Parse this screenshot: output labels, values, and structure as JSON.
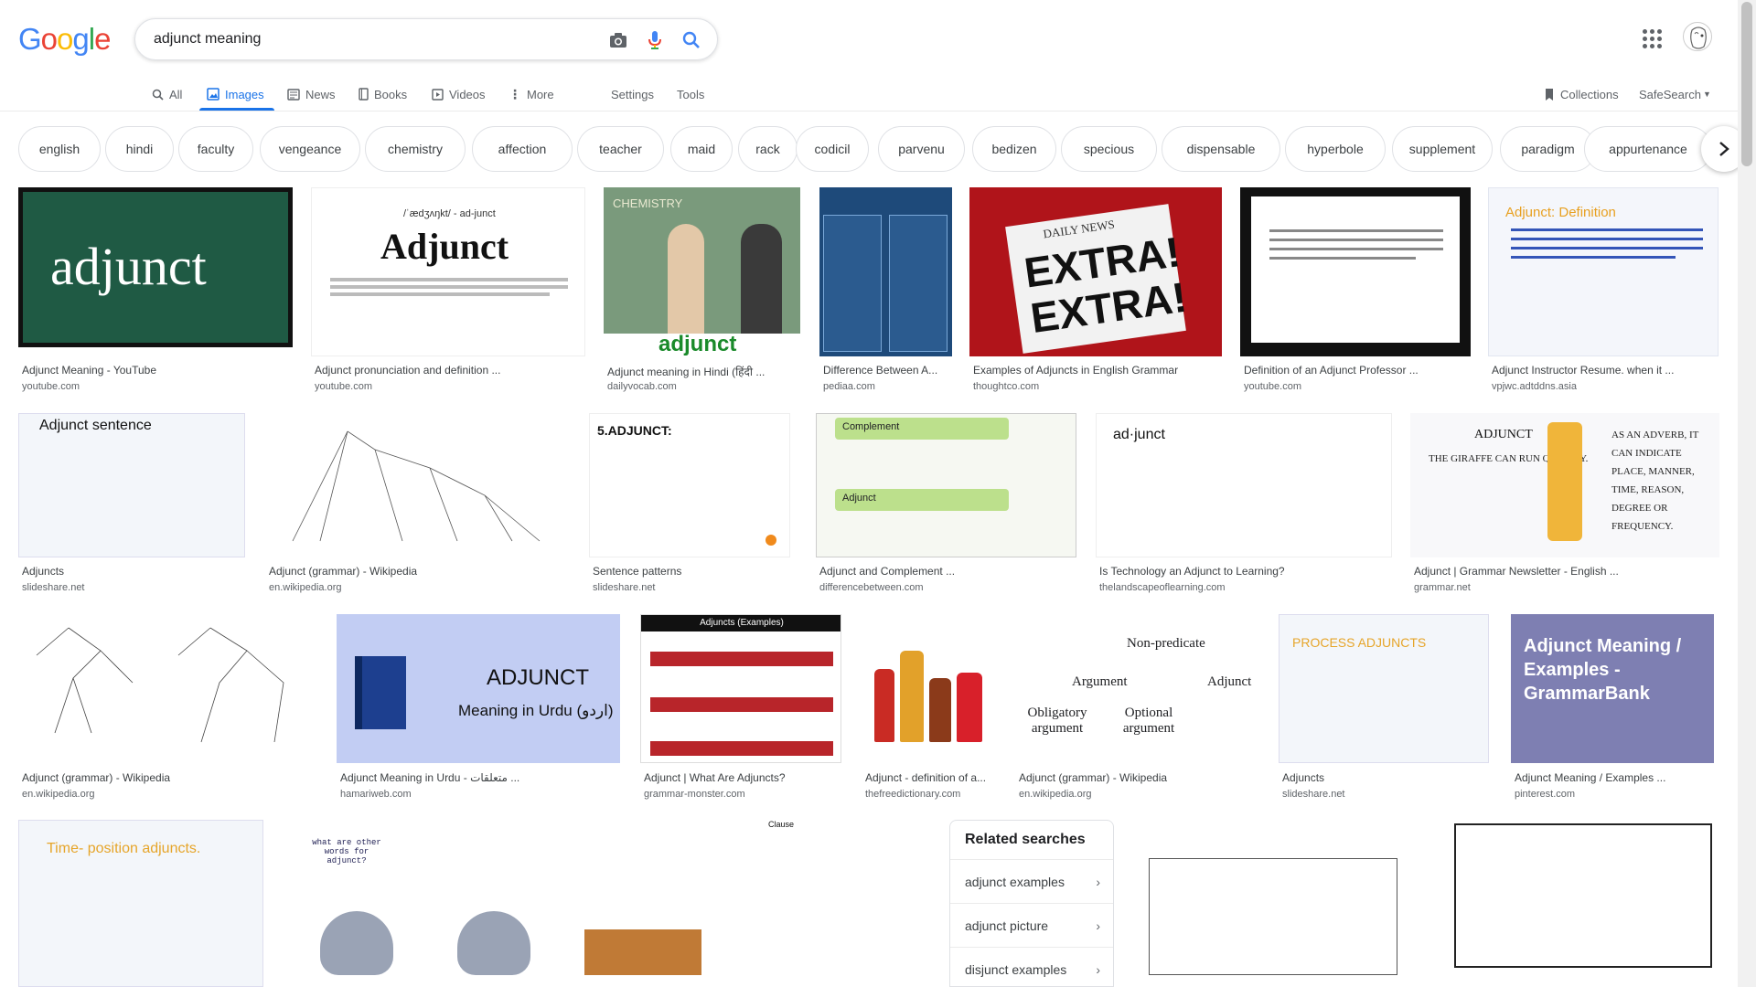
{
  "logo": {
    "letters": [
      "G",
      "o",
      "o",
      "g",
      "l",
      "e"
    ],
    "colors": [
      "#4285f4",
      "#ea4335",
      "#fbbc05",
      "#4285f4",
      "#34a853",
      "#ea4335"
    ]
  },
  "search": {
    "query": "adjunct meaning"
  },
  "nav": {
    "tabs": [
      {
        "label": "All"
      },
      {
        "label": "Images"
      },
      {
        "label": "News"
      },
      {
        "label": "Books"
      },
      {
        "label": "Videos"
      },
      {
        "label": "More"
      }
    ],
    "settings": "Settings",
    "tools": "Tools",
    "collections": "Collections",
    "safesearch": "SafeSearch"
  },
  "chips": [
    "english",
    "hindi",
    "faculty",
    "vengeance",
    "chemistry",
    "affection",
    "teacher",
    "maid",
    "rack",
    "codicil",
    "parvenu",
    "bedizen",
    "specious",
    "dispensable",
    "hyperbole",
    "supplement",
    "paradigm",
    "appurtenance"
  ],
  "results": [
    {
      "title": "Adjunct Meaning - YouTube",
      "source": "youtube.com"
    },
    {
      "title": "Adjunct pronunciation and definition ...",
      "source": "youtube.com"
    },
    {
      "title": "Adjunct meaning in Hindi (हिंदी ...",
      "source": "dailyvocab.com"
    },
    {
      "title": "Difference Between A...",
      "source": "pediaa.com"
    },
    {
      "title": "Examples of Adjuncts in English Grammar",
      "source": "thoughtco.com"
    },
    {
      "title": "Definition of an Adjunct Professor ...",
      "source": "youtube.com"
    },
    {
      "title": "Adjunct Instructor Resume. when it ...",
      "source": "vpjwc.adtddns.asia"
    },
    {
      "title": "Adjuncts",
      "source": "slideshare.net"
    },
    {
      "title": "Adjunct (grammar) - Wikipedia",
      "source": "en.wikipedia.org"
    },
    {
      "title": "Sentence patterns",
      "source": "slideshare.net"
    },
    {
      "title": "Adjunct and Complement ...",
      "source": "differencebetween.com"
    },
    {
      "title": "Is Technology an Adjunct to Learning?",
      "source": "thelandscapeoflearning.com"
    },
    {
      "title": "Adjunct | Grammar Newsletter - English ...",
      "source": "grammar.net"
    },
    {
      "title": "Adjunct (grammar) - Wikipedia",
      "source": "en.wikipedia.org"
    },
    {
      "title": "Adjunct Meaning in Urdu - متعلقات ...",
      "source": "hamariweb.com"
    },
    {
      "title": "Adjunct | What Are Adjuncts?",
      "source": "grammar-monster.com"
    },
    {
      "title": "Adjunct - definition of a...",
      "source": "thefreedictionary.com"
    },
    {
      "title": "Adjunct (grammar) - Wikipedia",
      "source": "en.wikipedia.org"
    },
    {
      "title": "Adjuncts",
      "source": "slideshare.net"
    },
    {
      "title": "Adjunct Meaning / Examples ...",
      "source": "pinterest.com"
    }
  ],
  "thumb_texts": {
    "t0": "adjunct",
    "t1_phon": "/ˈædʒʌŋkt/ - ad-junct",
    "t1_word": "Adjunct",
    "t2_top": "CHEMISTRY",
    "t2_word": "adjunct",
    "t4_a": "DAILY NEWS",
    "t4_b": "EXTRA!",
    "t4_c": "EXTRA!",
    "t6": "Adjunct: Definition",
    "t7": "Adjunct sentence",
    "t9": "5.ADJUNCT:",
    "t10_a": "Complement",
    "t10_b": "Adjunct",
    "t11": "ad·junct",
    "t12_a": "ADJUNCT",
    "t12_b": "THE GIRAFFE CAN RUN QUICKLY.",
    "t12_c": "AS AN ADVERB, IT CAN INDICATE PLACE, MANNER, TIME, REASON, DEGREE OR FREQUENCY.",
    "t14_a": "ADJUNCT",
    "t14_b": "Meaning in Urdu (اردو)",
    "t15": "Adjuncts (Examples)",
    "t17_a": "Non-predicate",
    "t17_b": "Argument",
    "t17_c": "Adjunct",
    "t17_d": "Obligatory argument",
    "t17_e": "Optional argument",
    "t18": "PROCESS ADJUNCTS",
    "t19": "Adjunct Meaning / Examples - GrammarBank",
    "t20": "Time- position adjuncts.",
    "t21": "what are other words for adjunct?",
    "t23": "Clause"
  },
  "related": {
    "heading": "Related searches",
    "items": [
      "adjunct examples",
      "adjunct picture",
      "disjunct examples"
    ]
  }
}
